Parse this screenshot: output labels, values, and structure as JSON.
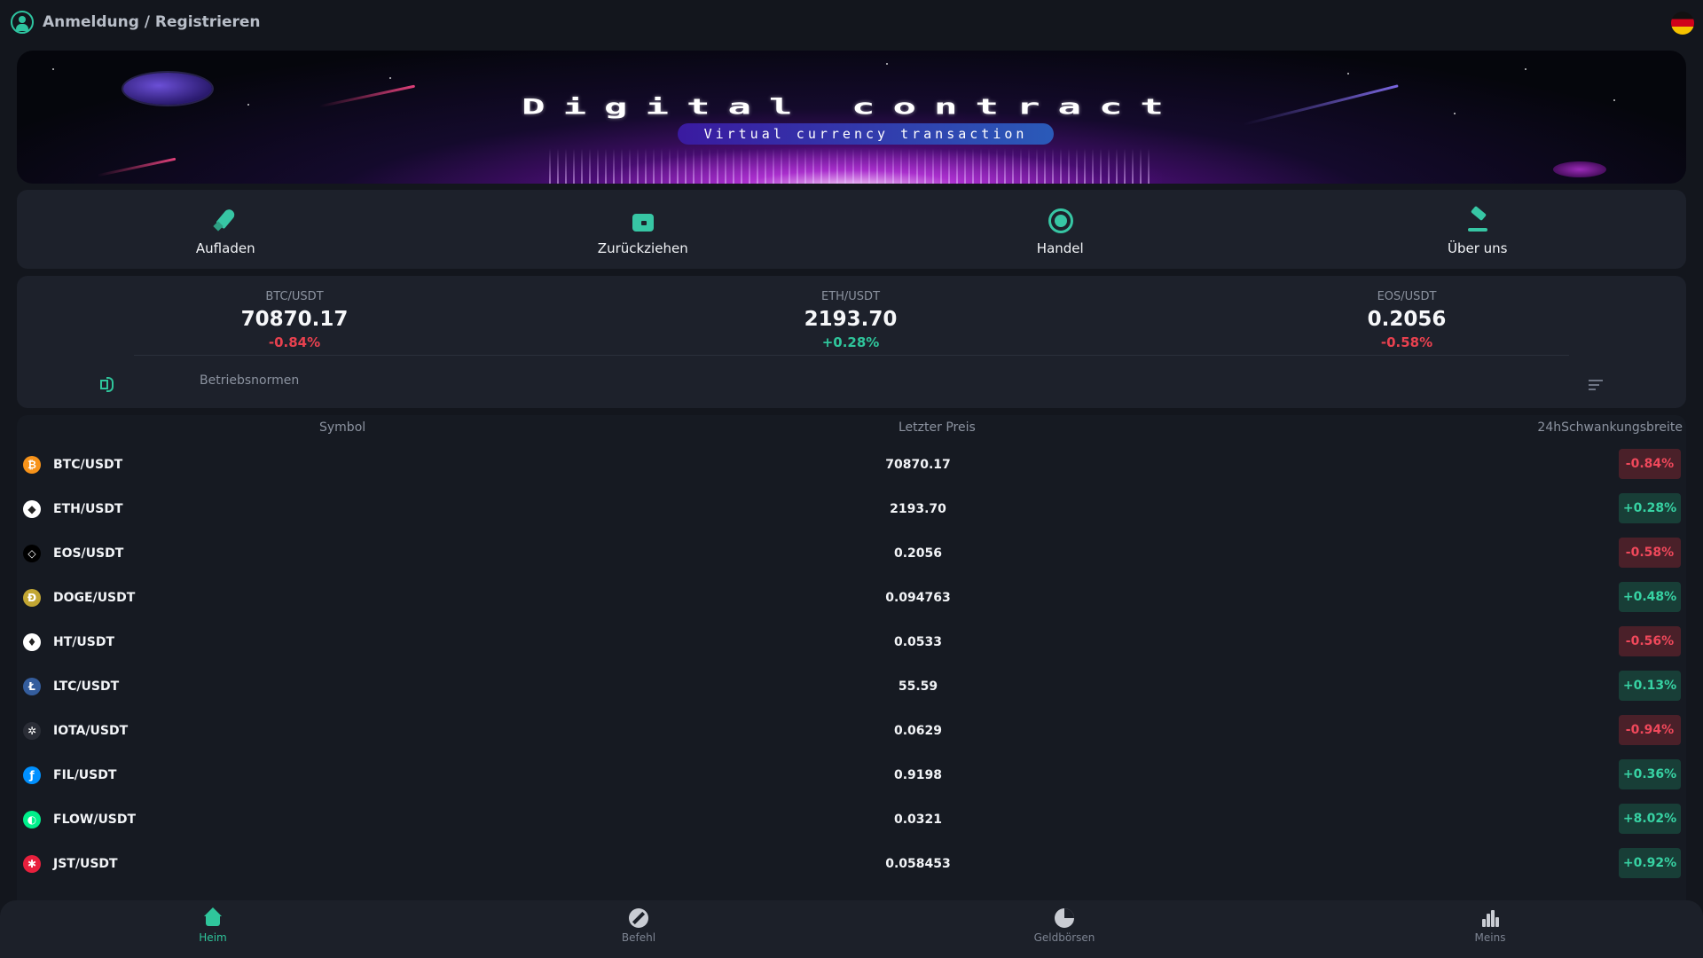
{
  "header": {
    "login_label": "Anmeldung / Registrieren"
  },
  "banner": {
    "title": "Digital contract",
    "subtitle": "Virtual currency transaction"
  },
  "quick_menu": [
    {
      "label": "Aufladen",
      "icon": "rocket-icon"
    },
    {
      "label": "Zurückziehen",
      "icon": "wallet-icon"
    },
    {
      "label": "Handel",
      "icon": "trade-icon"
    },
    {
      "label": "Über uns",
      "icon": "gavel-icon"
    }
  ],
  "ticker": [
    {
      "symbol": "BTC/USDT",
      "price": "70870.17",
      "change": "-0.84%",
      "dir": "down"
    },
    {
      "symbol": "ETH/USDT",
      "price": "2193.70",
      "change": "+0.28%",
      "dir": "up"
    },
    {
      "symbol": "EOS/USDT",
      "price": "0.2056",
      "change": "-0.58%",
      "dir": "down"
    }
  ],
  "notice": {
    "text": "Betriebsnormen"
  },
  "market": {
    "headers": {
      "symbol": "Symbol",
      "price": "Letzter Preis",
      "change": "24hSchwankungsbreite"
    },
    "rows": [
      {
        "symbol": "BTC/USDT",
        "price": "70870.17",
        "change": "-0.84%",
        "dir": "down",
        "coin_color": "#f7931a",
        "coin_glyph": "₿"
      },
      {
        "symbol": "ETH/USDT",
        "price": "2193.70",
        "change": "+0.28%",
        "dir": "up",
        "coin_color": "#ffffff",
        "coin_glyph": "◆"
      },
      {
        "symbol": "EOS/USDT",
        "price": "0.2056",
        "change": "-0.58%",
        "dir": "down",
        "coin_color": "#000000",
        "coin_glyph": "◇"
      },
      {
        "symbol": "DOGE/USDT",
        "price": "0.094763",
        "change": "+0.48%",
        "dir": "up",
        "coin_color": "#c2a633",
        "coin_glyph": "Ð"
      },
      {
        "symbol": "HT/USDT",
        "price": "0.0533",
        "change": "-0.56%",
        "dir": "down",
        "coin_color": "#ffffff",
        "coin_glyph": "♦"
      },
      {
        "symbol": "LTC/USDT",
        "price": "55.59",
        "change": "+0.13%",
        "dir": "up",
        "coin_color": "#345d9d",
        "coin_glyph": "Ł"
      },
      {
        "symbol": "IOTA/USDT",
        "price": "0.0629",
        "change": "-0.94%",
        "dir": "down",
        "coin_color": "#2a2d36",
        "coin_glyph": "✲"
      },
      {
        "symbol": "FIL/USDT",
        "price": "0.9198",
        "change": "+0.36%",
        "dir": "up",
        "coin_color": "#0090ff",
        "coin_glyph": "ƒ"
      },
      {
        "symbol": "FLOW/USDT",
        "price": "0.0321",
        "change": "+8.02%",
        "dir": "up",
        "coin_color": "#00ef8b",
        "coin_glyph": "◐"
      },
      {
        "symbol": "JST/USDT",
        "price": "0.058453",
        "change": "+0.92%",
        "dir": "up",
        "coin_color": "#e8203d",
        "coin_glyph": "✱"
      }
    ]
  },
  "bottom_nav": [
    {
      "label": "Heim",
      "icon": "home-icon",
      "active": true
    },
    {
      "label": "Befehl",
      "icon": "order-icon",
      "active": false
    },
    {
      "label": "Geldbörsen",
      "icon": "pie-chart-icon",
      "active": false
    },
    {
      "label": "Meins",
      "icon": "bar-chart-icon",
      "active": false
    }
  ],
  "colors": {
    "accent": "#2fc59b",
    "down": "#e8414f",
    "up": "#2fc59b",
    "background": "#13161d",
    "card": "#1d212b"
  }
}
